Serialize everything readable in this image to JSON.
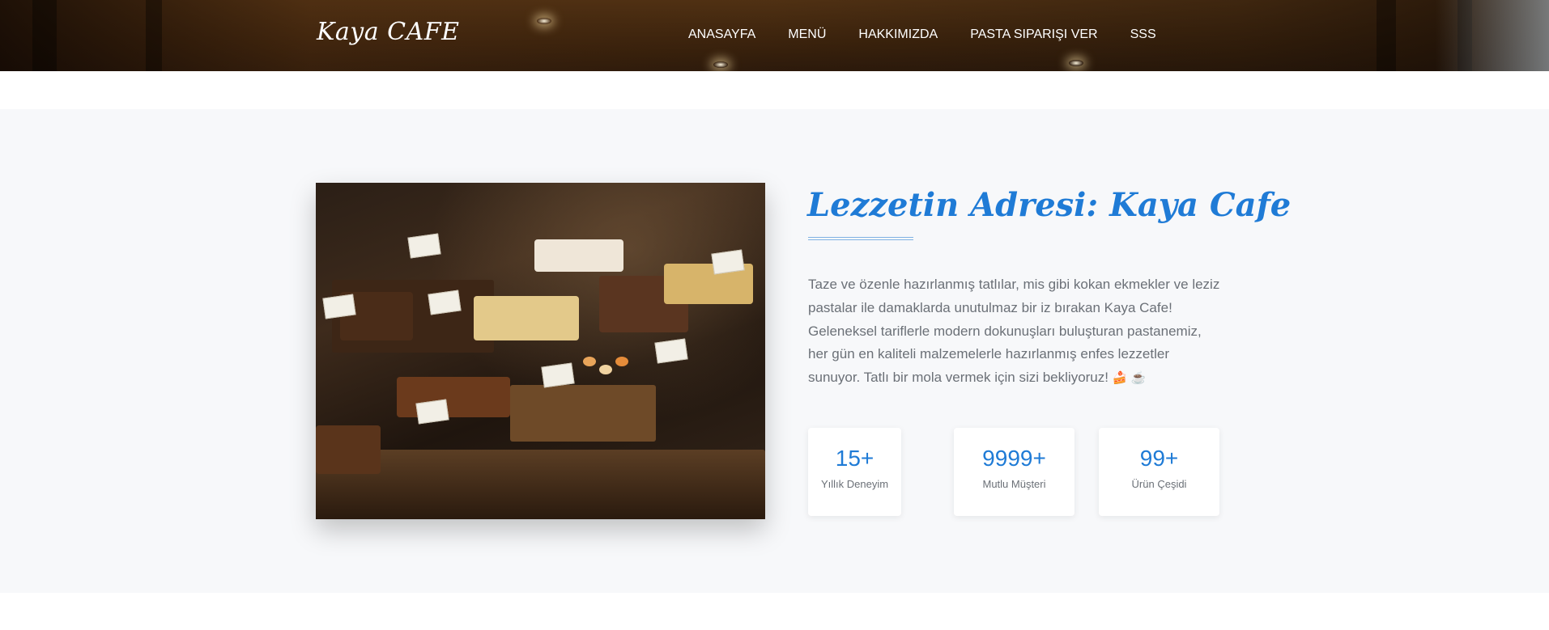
{
  "header": {
    "brand": "Kaya CAFE",
    "nav": [
      "ANASAYFA",
      "MENÜ",
      "HAKKIMIZDA",
      "PASTA SIPARIŞI VER",
      "SSS"
    ]
  },
  "about": {
    "title": "Lezzetin Adresi: Kaya Cafe",
    "description": "Taze ve özenle hazırlanmış tatlılar, mis gibi kokan ekmekler ve leziz pastalar ile damaklarda unutulmaz bir iz bırakan Kaya Cafe! Geleneksel tariflerle modern dokunuşları buluşturan pastanemiz, her gün en kaliteli malzemelerle hazırlanmış enfes lezzetler sunuyor. Tatlı bir mola vermek için sizi bekliyoruz!",
    "emojis": "🍰 ☕",
    "photo_icon": "bakery-display-photo",
    "stats": [
      {
        "value": "15+",
        "label": "Yıllık Deneyim"
      },
      {
        "value": "9999+",
        "label": "Mutlu Müşteri"
      },
      {
        "value": "99+",
        "label": "Ürün Çeşidi"
      }
    ]
  },
  "colors": {
    "accent": "#1f7bd6",
    "text_muted": "#6b7077",
    "section_bg": "#f7f8fa"
  }
}
